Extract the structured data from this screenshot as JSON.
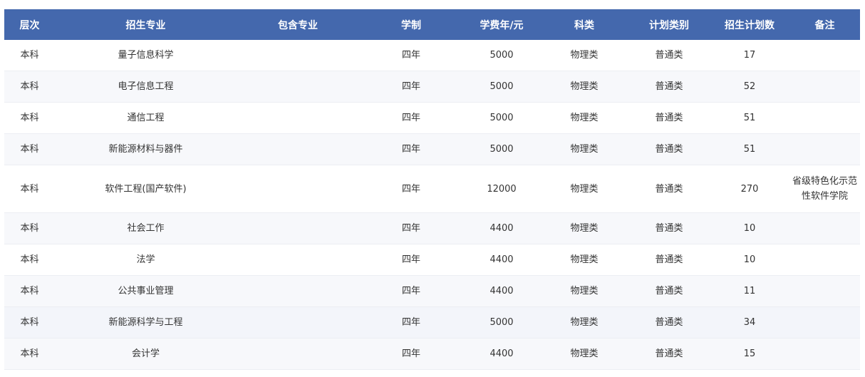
{
  "headers": [
    "层次",
    "招生专业",
    "包含专业",
    "学制",
    "学费年/元",
    "科类",
    "计划类别",
    "招生计划数",
    "备注"
  ],
  "rows": [
    {
      "level": "本科",
      "major": "量子信息科学",
      "includes": "",
      "duration": "四年",
      "tuition": "5000",
      "category": "物理类",
      "plan_type": "普通类",
      "plan_count": "17",
      "remark": ""
    },
    {
      "level": "本科",
      "major": "电子信息工程",
      "includes": "",
      "duration": "四年",
      "tuition": "5000",
      "category": "物理类",
      "plan_type": "普通类",
      "plan_count": "52",
      "remark": ""
    },
    {
      "level": "本科",
      "major": "通信工程",
      "includes": "",
      "duration": "四年",
      "tuition": "5000",
      "category": "物理类",
      "plan_type": "普通类",
      "plan_count": "51",
      "remark": ""
    },
    {
      "level": "本科",
      "major": "新能源材料与器件",
      "includes": "",
      "duration": "四年",
      "tuition": "5000",
      "category": "物理类",
      "plan_type": "普通类",
      "plan_count": "51",
      "remark": ""
    },
    {
      "level": "本科",
      "major": "软件工程(国产软件)",
      "includes": "",
      "duration": "四年",
      "tuition": "12000",
      "category": "物理类",
      "plan_type": "普通类",
      "plan_count": "270",
      "remark": "省级特色化示范性软件学院"
    },
    {
      "level": "本科",
      "major": "社会工作",
      "includes": "",
      "duration": "四年",
      "tuition": "4400",
      "category": "物理类",
      "plan_type": "普通类",
      "plan_count": "10",
      "remark": ""
    },
    {
      "level": "本科",
      "major": "法学",
      "includes": "",
      "duration": "四年",
      "tuition": "4400",
      "category": "物理类",
      "plan_type": "普通类",
      "plan_count": "10",
      "remark": ""
    },
    {
      "level": "本科",
      "major": "公共事业管理",
      "includes": "",
      "duration": "四年",
      "tuition": "4400",
      "category": "物理类",
      "plan_type": "普通类",
      "plan_count": "11",
      "remark": ""
    },
    {
      "level": "本科",
      "major": "新能源科学与工程",
      "includes": "",
      "duration": "四年",
      "tuition": "5000",
      "category": "物理类",
      "plan_type": "普通类",
      "plan_count": "34",
      "remark": ""
    },
    {
      "level": "本科",
      "major": "会计学",
      "includes": "",
      "duration": "四年",
      "tuition": "4400",
      "category": "物理类",
      "plan_type": "普通类",
      "plan_count": "15",
      "remark": ""
    }
  ],
  "colors": {
    "header_bg": "#4468ad",
    "header_text": "#ffffff",
    "row_alt": "#f7f8fb",
    "border": "#eceef3"
  }
}
